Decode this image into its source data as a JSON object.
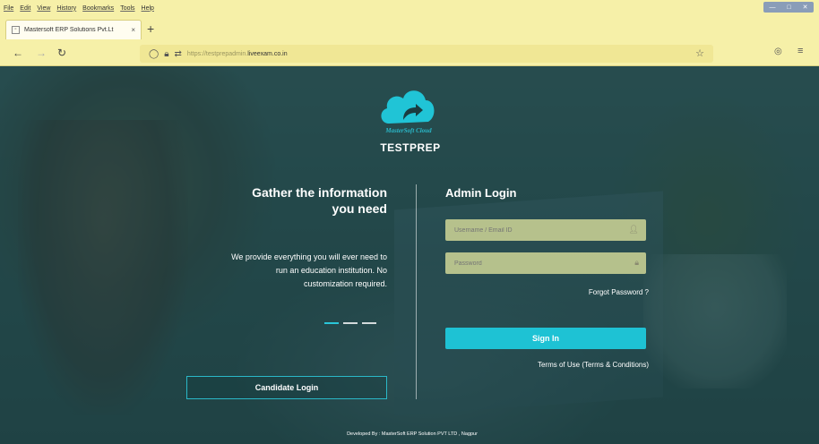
{
  "browser": {
    "menu": [
      "File",
      "Edit",
      "View",
      "History",
      "Bookmarks",
      "Tools",
      "Help"
    ],
    "tab_title": "Mastersoft ERP Solutions Pvt.Lt",
    "tab_close": "×",
    "new_tab": "+",
    "url_prefix": "https://testprepadmin.",
    "url_domain": "liveexam.co.in",
    "window_controls": [
      "—",
      "□",
      "✕"
    ]
  },
  "page": {
    "logo_caption": "MasterSoft Cloud",
    "brand": "TESTPREP",
    "left_heading_line1": "Gather the information",
    "left_heading_line2": "you need",
    "left_desc_line1": "We provide everything you will ever need to",
    "left_desc_line2": "run an education institution. No",
    "left_desc_line3": "customization required.",
    "candidate_login": "Candidate Login",
    "admin_heading": "Admin Login",
    "username_placeholder": "Username / Email ID",
    "password_placeholder": "Password",
    "forgot_password": "Forgot Password ?",
    "sign_in": "Sign In",
    "terms": "Terms of Use (Terms & Conditions)",
    "footer": "Developed By : MasterSoft ERP Solution PVT LTD , Nagpur"
  },
  "colors": {
    "accent": "#1ec2d4",
    "browser_chrome": "#f6f0a8",
    "overlay": "#1e5c62"
  }
}
